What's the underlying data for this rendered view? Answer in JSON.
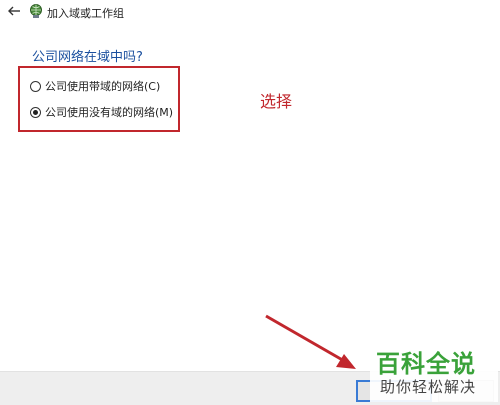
{
  "window": {
    "title": "加入域或工作组"
  },
  "form": {
    "question": "公司网络在域中吗?",
    "options": [
      {
        "label": "公司使用带域的网络(C)",
        "selected": false
      },
      {
        "label": "公司使用没有域的网络(M)",
        "selected": true
      }
    ]
  },
  "annotation": {
    "text": "选择",
    "color": "#c1272d"
  },
  "watermark": {
    "title": "百科全说",
    "subtitle": "助你轻松解决",
    "color": "#3aa23a"
  },
  "colors": {
    "accent": "#3a7bd5",
    "question_text": "#1a4f9e"
  },
  "icons": {
    "back": "back-arrow-icon",
    "network": "network-globe-icon",
    "pointer": "red-arrow-icon"
  }
}
